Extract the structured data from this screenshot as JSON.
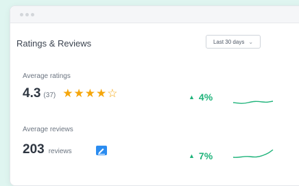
{
  "card": {
    "title": "Ratings & Reviews",
    "range_select": {
      "value": "Last 30 days",
      "icon": "chevron-down-icon"
    }
  },
  "ratings": {
    "label": "Average ratings",
    "value": "4.3",
    "count": "(37)",
    "stars_filled": 4,
    "stars_total": 5,
    "trend_percent": "4%",
    "trend_direction": "up"
  },
  "reviews": {
    "label": "Average reviews",
    "value": "203",
    "unit": "reviews",
    "trend_percent": "7%",
    "trend_direction": "up"
  },
  "colors": {
    "star": "#f5a60b",
    "positive": "#1eb37a",
    "review_icon": "#2b8cf0",
    "background": "#dff5f0"
  }
}
